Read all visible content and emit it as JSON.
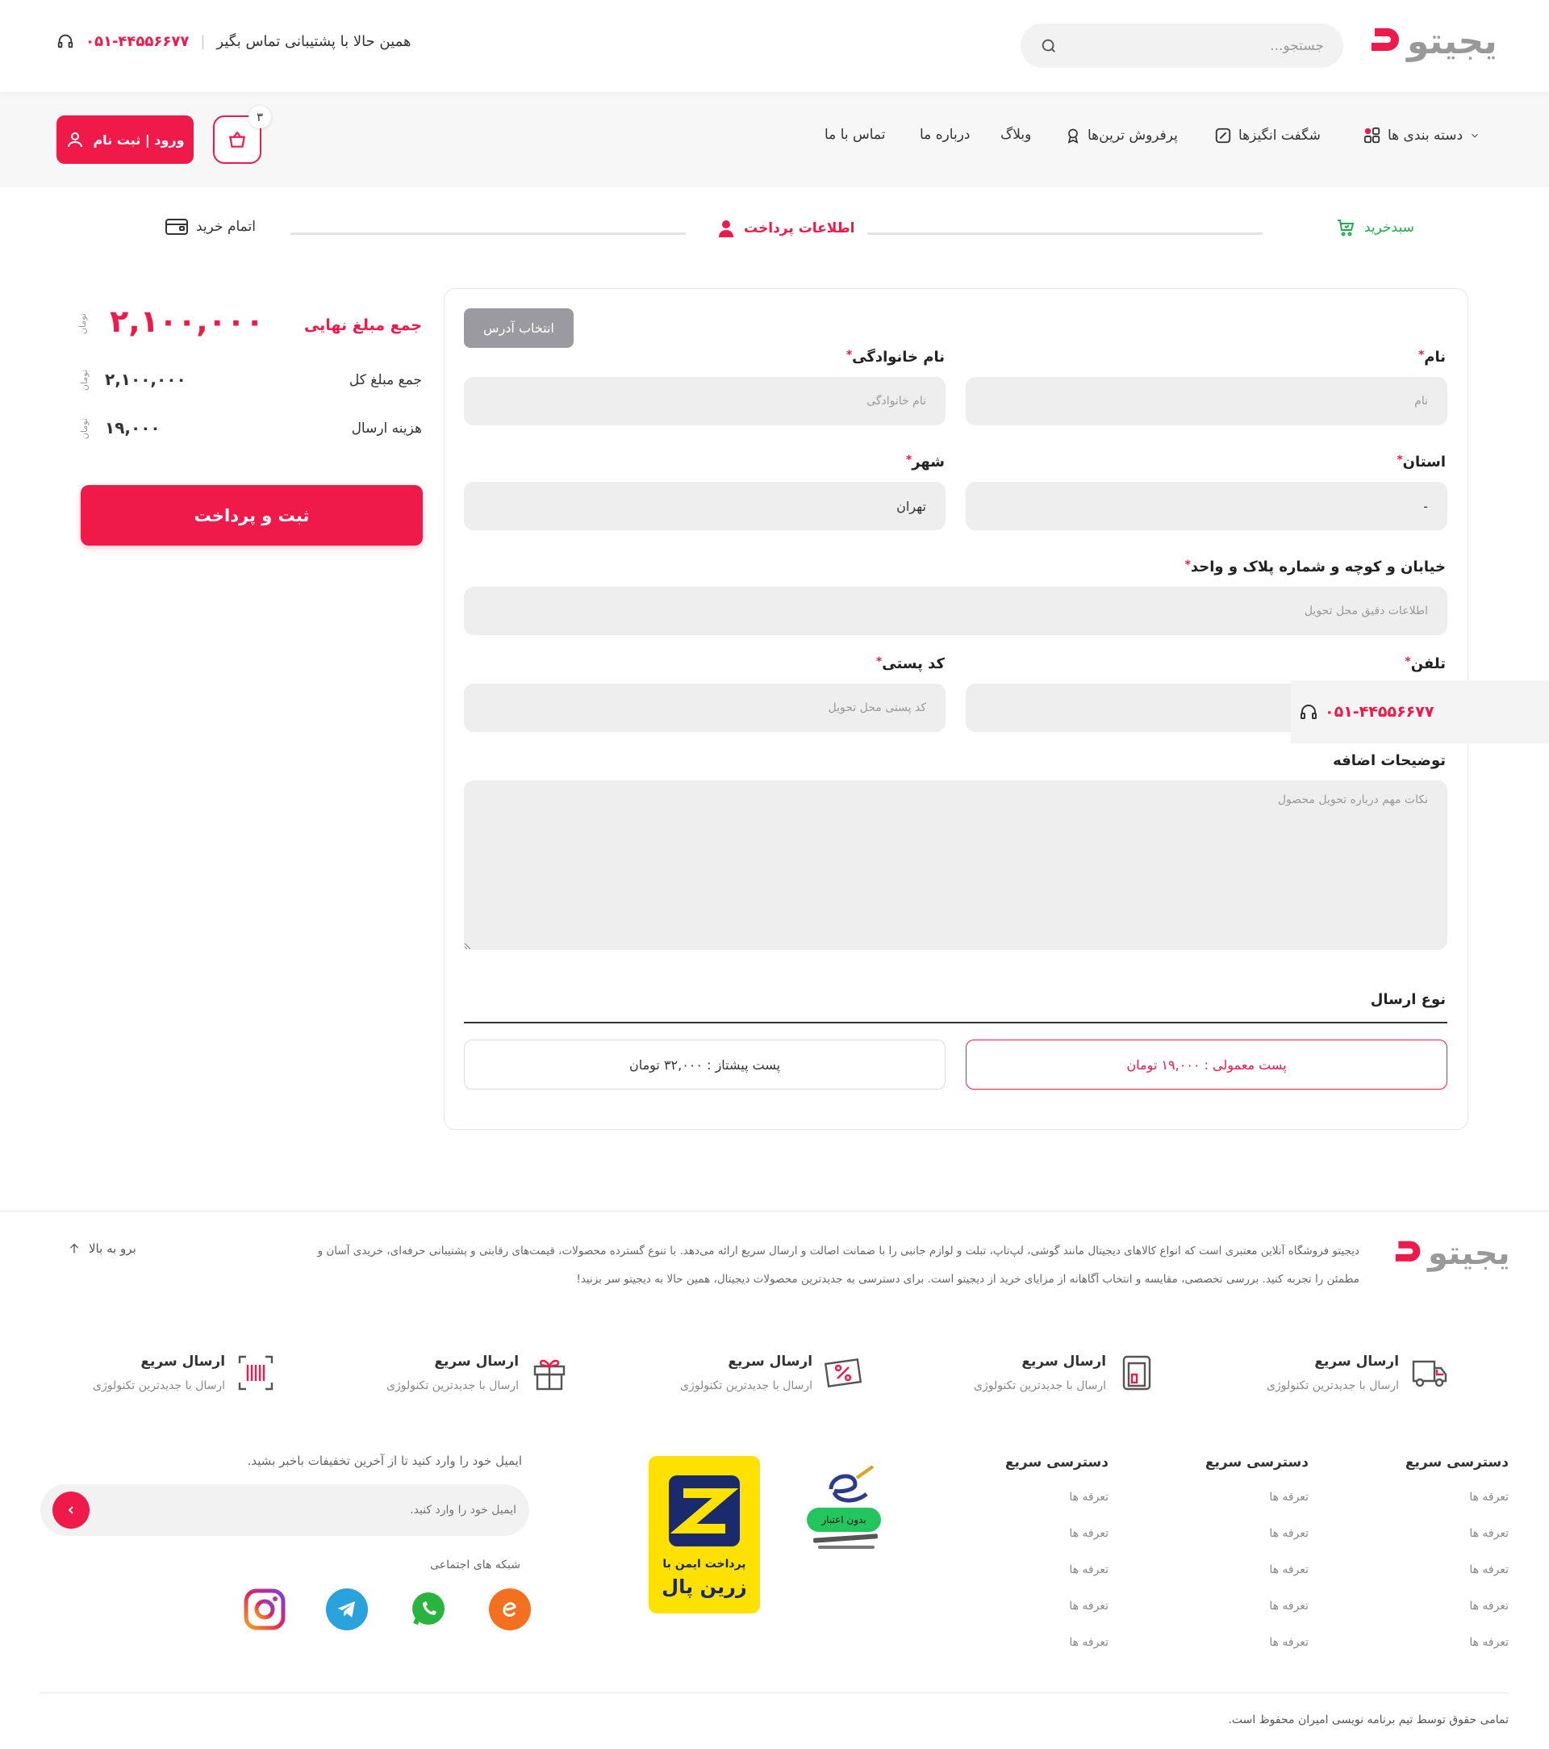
{
  "header": {
    "logo_text": "یجیتو",
    "search_placeholder": "جستجو...",
    "support_text": "همین حالا با پشتیبانی تماس بگیر",
    "phone": "۰۵۱-۴۴۵۵۶۶۷۷"
  },
  "nav": {
    "items": [
      {
        "label": "دسته بندی ها"
      },
      {
        "label": "شگفت انگیزها"
      },
      {
        "label": "پرفروش ترین‌ها"
      },
      {
        "label": "وبلاگ"
      },
      {
        "label": "درباره ما"
      },
      {
        "label": "تماس با ما"
      }
    ],
    "cart_count": "۳",
    "login_label": "ورود | ثبت نام"
  },
  "steps": [
    {
      "label": "سبدخرید",
      "color": "#1fae4b"
    },
    {
      "label": "اطلاعات پرداخت",
      "color": "#ef1a4a"
    },
    {
      "label": "اتمام خرید",
      "color": "#333333"
    }
  ],
  "form": {
    "select_address": "انتخاب آدرس",
    "first_name": {
      "label": "نام",
      "placeholder": "نام"
    },
    "last_name": {
      "label": "نام خانوادگی",
      "placeholder": "نام خانوادگی"
    },
    "province": {
      "label": "استان",
      "value": "-"
    },
    "city": {
      "label": "شهر",
      "value": "تهران"
    },
    "address": {
      "label": "خیابان و کوچه و شماره پلاک و واحد",
      "placeholder": "اطلاعات دقیق محل تحویل"
    },
    "phone": {
      "label": "تلفن"
    },
    "postal": {
      "label": "کد پستی",
      "placeholder": "کد پستی محل تحویل"
    },
    "notes": {
      "label": "توضیحات اضافه",
      "placeholder": "نکات مهم درباره تحویل محصول"
    },
    "required_mark": "*",
    "shipping_title": "نوع ارسال",
    "shipping_options": [
      {
        "label": "پست معمولی : ۱۹,۰۰۰ تومان",
        "selected": true
      },
      {
        "label": "پست پیشتاز : ۳۲,۰۰۰ تومان",
        "selected": false
      }
    ]
  },
  "floating_phone": "۰۵۱-۴۴۵۵۶۶۷۷",
  "summary": {
    "final_label": "جمع مبلغ نهایی",
    "final_value": "۲,۱۰۰,۰۰۰",
    "total_label": "جمع مبلغ کل",
    "total_value": "۲,۱۰۰,۰۰۰",
    "shipping_label": "هزینه ارسال",
    "shipping_value": "۱۹,۰۰۰",
    "currency": "تومان",
    "pay_button": "ثبت و پرداخت"
  },
  "footer": {
    "logo_text": "یجیتو",
    "back_to_top": "برو به بالا",
    "about_line1": "دیجیتو فروشگاه آنلاین معتبری است که انواع کالاهای دیجیتال مانند گوشی، لپ‌تاپ، تبلت و لوازم جانبی را با ضمانت اصالت و ارسال سریع ارائه می‌دهد. با تنوع گسترده محصولات، قیمت‌های رقابتی و پشتیبانی حرفه‌ای، خریدی آسان و",
    "about_line2": "مطمئن را تجربه کنید. بررسی تخصصی، مقایسه و انتخاب آگاهانه از مزایای خرید از دیجیتو است. برای دسترسی به جدیدترین محصولات دیجیتال، همین حالا به دیجیتو سر بزنید!",
    "features": [
      {
        "title": "ارسال سریع",
        "sub": "ارسال با جدیدترین تکنولوژی",
        "icon": "truck-icon"
      },
      {
        "title": "ارسال سریع",
        "sub": "ارسال با جدیدترین تکنولوژی",
        "icon": "wallet-icon"
      },
      {
        "title": "ارسال سریع",
        "sub": "ارسال با جدیدترین تکنولوژی",
        "icon": "discount-icon"
      },
      {
        "title": "ارسال سریع",
        "sub": "ارسال با جدیدترین تکنولوژی",
        "icon": "gift-icon"
      },
      {
        "title": "ارسال سریع",
        "sub": "ارسال با جدیدترین تکنولوژی",
        "icon": "barcode-icon"
      }
    ],
    "link_columns": [
      {
        "title": "دسترسی سریع",
        "links": [
          "تعرفه ها",
          "تعرفه ها",
          "تعرفه ها",
          "تعرفه ها",
          "تعرفه ها"
        ]
      },
      {
        "title": "دسترسی سریع",
        "links": [
          "تعرفه ها",
          "تعرفه ها",
          "تعرفه ها",
          "تعرفه ها",
          "تعرفه ها"
        ]
      },
      {
        "title": "دسترسی سریع",
        "links": [
          "تعرفه ها",
          "تعرفه ها",
          "تعرفه ها",
          "تعرفه ها",
          "تعرفه ها"
        ]
      }
    ],
    "enamad_badge": "بدون اعتبار",
    "zarinpal_text": "پرداخت ایمن با",
    "zarinpal_brand": "زرین پال",
    "newsletter_text": "ایمیل خود را وارد کنید تا از آخرین تخفیفات باخبر بشید.",
    "email_placeholder": "ایمیل خود را وارد کنید.",
    "social_title": "شبکه های اجتماعی",
    "copyright": "تمامی حقوق توسط تیم برنامه نویسی امیران محفوظ است."
  },
  "colors": {
    "brand": "#ef1a4a",
    "success": "#1fae4b"
  }
}
